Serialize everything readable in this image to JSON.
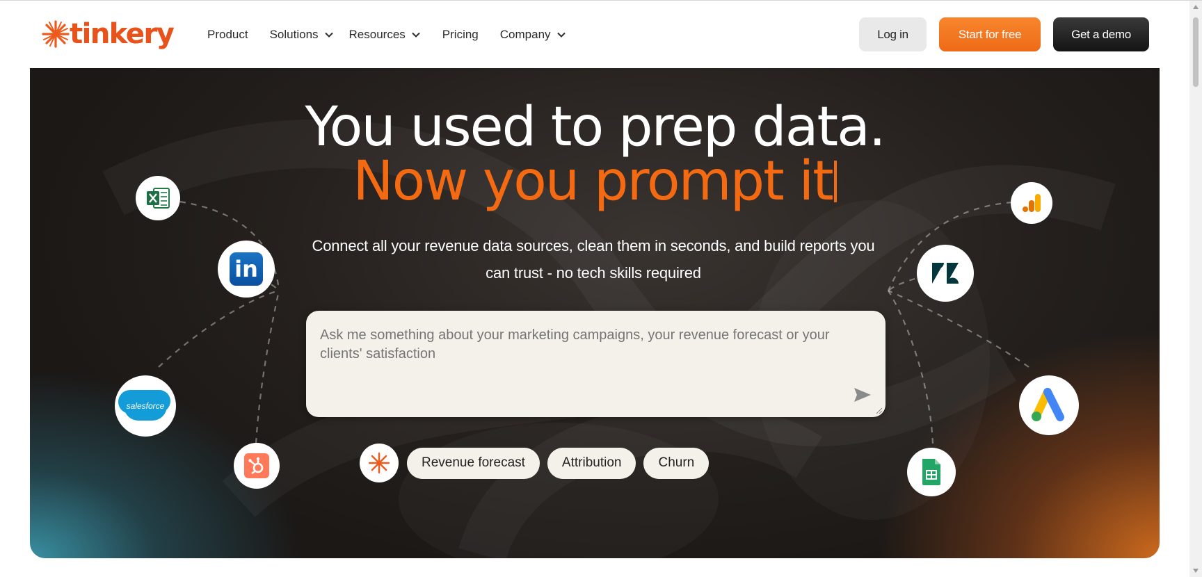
{
  "brand": {
    "name": "tinkery",
    "color": "#e8531c"
  },
  "nav": {
    "product": "Product",
    "solutions": "Solutions",
    "resources": "Resources",
    "pricing": "Pricing",
    "company": "Company"
  },
  "header_buttons": {
    "login": "Log in",
    "start": "Start for free",
    "demo": "Get a demo"
  },
  "hero": {
    "headline_line1": "You used to prep data.",
    "headline_line2": "Now you prompt it",
    "subtitle": "Connect all your revenue data sources, clean them in seconds, and build reports you can trust - no tech skills required",
    "prompt_placeholder": "Ask me something about your marketing campaigns, your revenue forecast or your clients' satisfaction",
    "chips": [
      "Revenue forecast",
      "Attribution",
      "Churn"
    ],
    "accent_color": "#f46a12"
  },
  "integrations": {
    "left": [
      "excel-icon",
      "linkedin-icon",
      "salesforce-icon",
      "hubspot-icon"
    ],
    "right": [
      "google-analytics-icon",
      "zendesk-icon",
      "google-ads-icon",
      "google-sheets-icon"
    ],
    "salesforce_label": "salesforce",
    "linkedin_label": "in"
  }
}
